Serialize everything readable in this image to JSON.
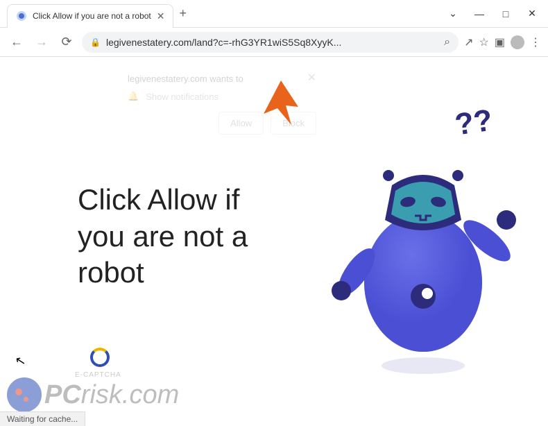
{
  "window": {
    "tab_title": "Click Allow if you are not a robot",
    "dropdown_icon": "chevron-down",
    "minimize": "—",
    "maximize": "□",
    "close": "✕"
  },
  "toolbar": {
    "back": "←",
    "forward": "→",
    "reload": "⟳",
    "url": "legivenestatery.com/land?c=-rhG3YR1wiS5Sq8XyyK...",
    "search_icon": "⌕",
    "share_icon": "↗",
    "star_icon": "☆",
    "ext_icon": "▣",
    "menu_icon": "⋮"
  },
  "notification": {
    "origin": "legivenestatery.com wants to",
    "permission": "Show notifications",
    "allow": "Allow",
    "block": "Block",
    "close": "✕",
    "bell": "🔔"
  },
  "page": {
    "headline_l1": "Click Allow if",
    "headline_l2": "you are not a",
    "headline_l3": "robot",
    "qmarks": "??",
    "captcha_label": "E-CAPTCHA"
  },
  "watermark": {
    "prefix": "PC",
    "suffix": "risk.com"
  },
  "status": {
    "text": "Waiting for cache..."
  }
}
